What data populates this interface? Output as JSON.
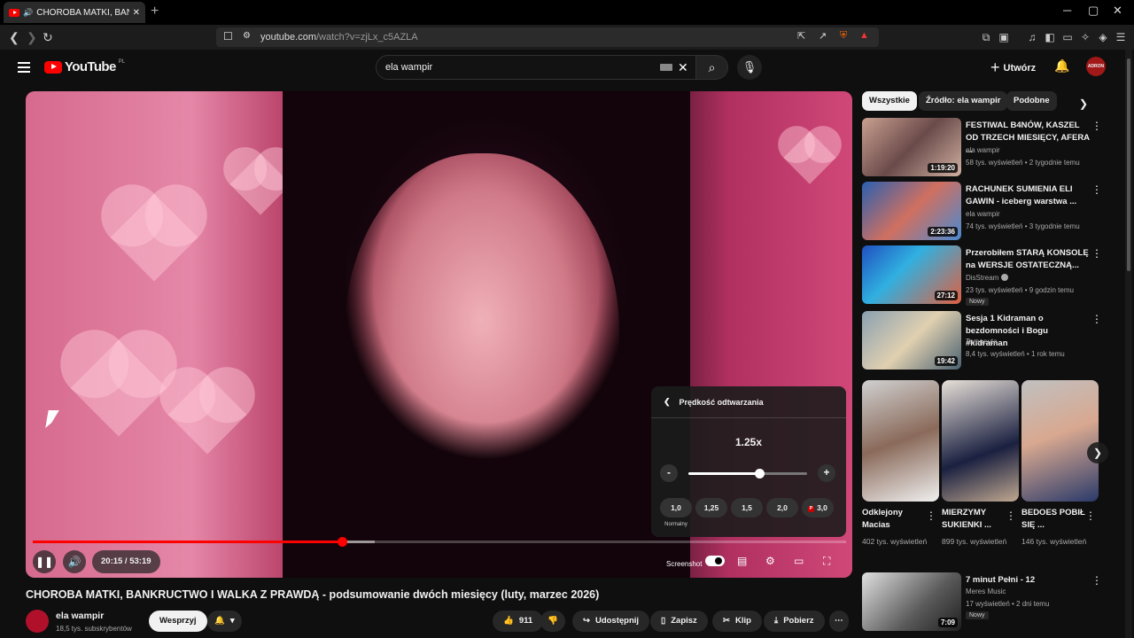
{
  "browser": {
    "tab_title": "CHOROBA MATKI, BANKRUCTWO",
    "new_tab": "+",
    "url_domain": "youtube.com",
    "url_path": "/watch?v=zjLx_c5AZLA",
    "window_controls": [
      "─",
      "▢",
      "✕"
    ]
  },
  "header": {
    "logo": "YouTube",
    "logo_country": "PL",
    "search_query": "ela wampir",
    "create_label": "Utwórz",
    "avatar_text": "ADRON"
  },
  "player": {
    "speed_panel_title": "Prędkość odtwarzania",
    "current_speed": "1.25x",
    "minus": "-",
    "plus": "+",
    "speed_level": 0.6,
    "presets": [
      "1,0",
      "1,25",
      "1,5",
      "2,0",
      "3,0"
    ],
    "preset_premium_badge": "P",
    "normal_label": "Normalny",
    "time_display": "20:15 / 53:19",
    "progress": 0.38,
    "buffered": 0.42,
    "screenshot_label": "Screenshot"
  },
  "video": {
    "title": "CHOROBA MATKI, BANKRUCTWO I WALKA Z PRAWDĄ - podsumowanie dwóch miesięcy (luty, marzec 2026)",
    "channel": "ela wampir",
    "subscribers": "18,5 tys. subskrybentów",
    "support_label": "Wesprzyj",
    "likes": "911",
    "share_label": "Udostępnij",
    "save_label": "Zapisz",
    "clip_label": "Klip",
    "download_label": "Pobierz"
  },
  "sidebar": {
    "chips": [
      "Wszystkie",
      "Źródło: ela wampir",
      "Podobne"
    ],
    "videos": [
      {
        "title": "FESTIWAL B4NÓW, KASZEL OD TRZECH MIESIĘCY, AFERA ...",
        "channel": "ela wampir",
        "meta": "58 tys. wyświetleń • 2 tygodnie temu",
        "duration": "1:19:20"
      },
      {
        "title": "RACHUNEK SUMIENIA ELI GAWIN - iceberg warstwa ...",
        "channel": "ela wampir",
        "meta": "74 tys. wyświetleń • 3 tygodnie temu",
        "duration": "2:23:36"
      },
      {
        "title": "Przerobiłem STARĄ KONSOLĘ na WERSJE OSTATECZNĄ...",
        "channel": "DisStream",
        "meta": "23 tys. wyświetleń • 9 godzin temu",
        "duration": "27:12",
        "badge": "Nowy"
      },
      {
        "title": "Sesja 1 Kidraman o bezdomności i Bogu #kidraman",
        "channel": "Terapeuta",
        "meta": "8,4 tys. wyświetleń • 1 rok temu",
        "duration": "19:42"
      }
    ],
    "shorts": [
      {
        "title": "Odklejony Macias",
        "views": "402 tys. wyświetleń"
      },
      {
        "title": "MIERZYMY SUKIENKI ...",
        "views": "899 tys. wyświetleń"
      },
      {
        "title": "BEDOES POBIŁ SIĘ ...",
        "views": "146 tys. wyświetleń"
      }
    ],
    "last_video": {
      "title": "7 minut Pełni - 12",
      "channel": "Meres Music",
      "meta": "17 wyświetleń • 2 dni temu",
      "duration": "7:09",
      "badge": "Nowy"
    }
  },
  "colors": {
    "accent": "#ff0000",
    "bg": "#0f0f0f"
  }
}
